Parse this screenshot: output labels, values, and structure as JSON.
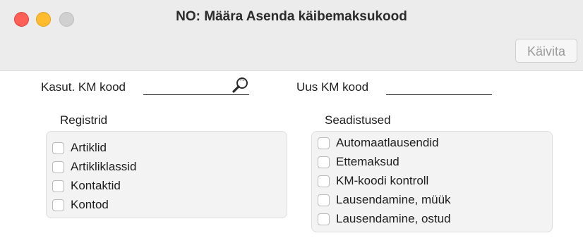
{
  "window": {
    "title": "NO: Määra Asenda käibemaksukood",
    "run_button": "Käivita"
  },
  "fields": {
    "old_code_label": "Kasut. KM kood",
    "old_code_value": "",
    "new_code_label": "Uus KM kood",
    "new_code_value": ""
  },
  "registers": {
    "heading": "Registrid",
    "items": [
      {
        "label": "Artiklid",
        "checked": false
      },
      {
        "label": "Artikliklassid",
        "checked": false
      },
      {
        "label": "Kontaktid",
        "checked": false
      },
      {
        "label": "Kontod",
        "checked": false
      }
    ]
  },
  "settings": {
    "heading": "Seadistused",
    "items": [
      {
        "label": "Automaatlausendid",
        "checked": false
      },
      {
        "label": "Ettemaksud",
        "checked": false
      },
      {
        "label": "KM-koodi kontroll",
        "checked": false
      },
      {
        "label": "Lausendamine, müük",
        "checked": false
      },
      {
        "label": "Lausendamine, ostud",
        "checked": false
      }
    ]
  },
  "icons": {
    "close": "close-icon",
    "minimize": "minimize-icon",
    "zoom": "zoom-icon",
    "search": "search-icon"
  },
  "colors": {
    "close": "#ff5f57",
    "minimize": "#febc2e",
    "zoom_disabled": "#d0d0d0",
    "titlebar_bg": "#ececec",
    "panel_bg": "#f3f3f3"
  }
}
